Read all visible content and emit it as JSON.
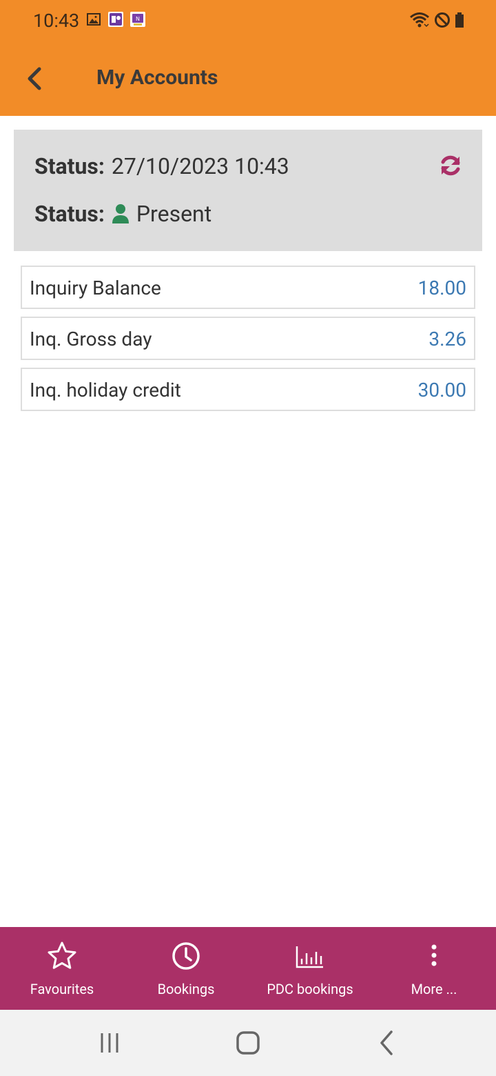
{
  "status_bar": {
    "time": "10:43",
    "notification_icons": [
      "gallery-icon",
      "teams-app-icon",
      "onenote-app-icon"
    ],
    "system_icons": [
      "wifi-icon",
      "do-not-disturb-icon",
      "battery-icon"
    ]
  },
  "app_bar": {
    "title": "My Accounts",
    "back_icon": "chevron-left-icon"
  },
  "status_card": {
    "time_label": "Status:",
    "time_value": "27/10/2023 10:43",
    "presence_label": "Status:",
    "presence_value": "Present",
    "presence_color": "#2e8b57",
    "refresh_color": "#aa3067"
  },
  "accounts": [
    {
      "label": "Inquiry Balance",
      "value": "18.00"
    },
    {
      "label": "Inq. Gross day",
      "value": "3.26"
    },
    {
      "label": "Inq. holiday credit",
      "value": "30.00"
    }
  ],
  "bottom_nav": [
    {
      "label": "Favourites",
      "icon": "star-icon"
    },
    {
      "label": "Bookings",
      "icon": "clock-icon"
    },
    {
      "label": "PDC bookings",
      "icon": "bar-chart-icon"
    },
    {
      "label": "More ...",
      "icon": "more-vertical-icon"
    }
  ],
  "colors": {
    "app_bar": "#f28c28",
    "bottom_nav": "#aa3067",
    "value_text": "#3c79b2"
  }
}
